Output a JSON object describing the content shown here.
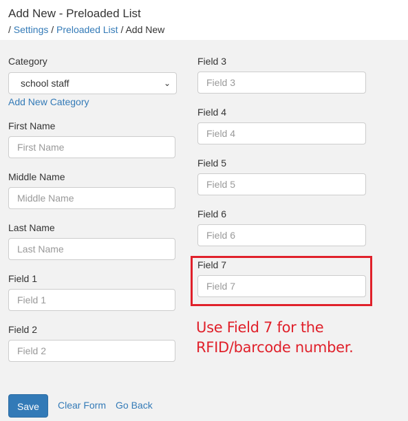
{
  "header": {
    "title": "Add New - Preloaded List",
    "breadcrumb": {
      "sep": "/",
      "items": [
        "Settings",
        "Preloaded List"
      ],
      "current": "Add New"
    }
  },
  "form": {
    "category": {
      "label": "Category",
      "value": "school staff",
      "add_link": "Add New Category"
    },
    "first_name": {
      "label": "First Name",
      "placeholder": "First Name"
    },
    "middle_name": {
      "label": "Middle Name",
      "placeholder": "Middle Name"
    },
    "last_name": {
      "label": "Last Name",
      "placeholder": "Last Name"
    },
    "field1": {
      "label": "Field 1",
      "placeholder": "Field 1"
    },
    "field2": {
      "label": "Field 2",
      "placeholder": "Field 2"
    },
    "field3": {
      "label": "Field 3",
      "placeholder": "Field 3"
    },
    "field4": {
      "label": "Field 4",
      "placeholder": "Field 4"
    },
    "field5": {
      "label": "Field 5",
      "placeholder": "Field 5"
    },
    "field6": {
      "label": "Field 6",
      "placeholder": "Field 6"
    },
    "field7": {
      "label": "Field 7",
      "placeholder": "Field 7"
    }
  },
  "annotation": {
    "line1": "Use Field 7 for the",
    "line2": "RFID/barcode number.",
    "color": "#e0202a"
  },
  "actions": {
    "save": "Save",
    "clear": "Clear Form",
    "back": "Go Back"
  }
}
